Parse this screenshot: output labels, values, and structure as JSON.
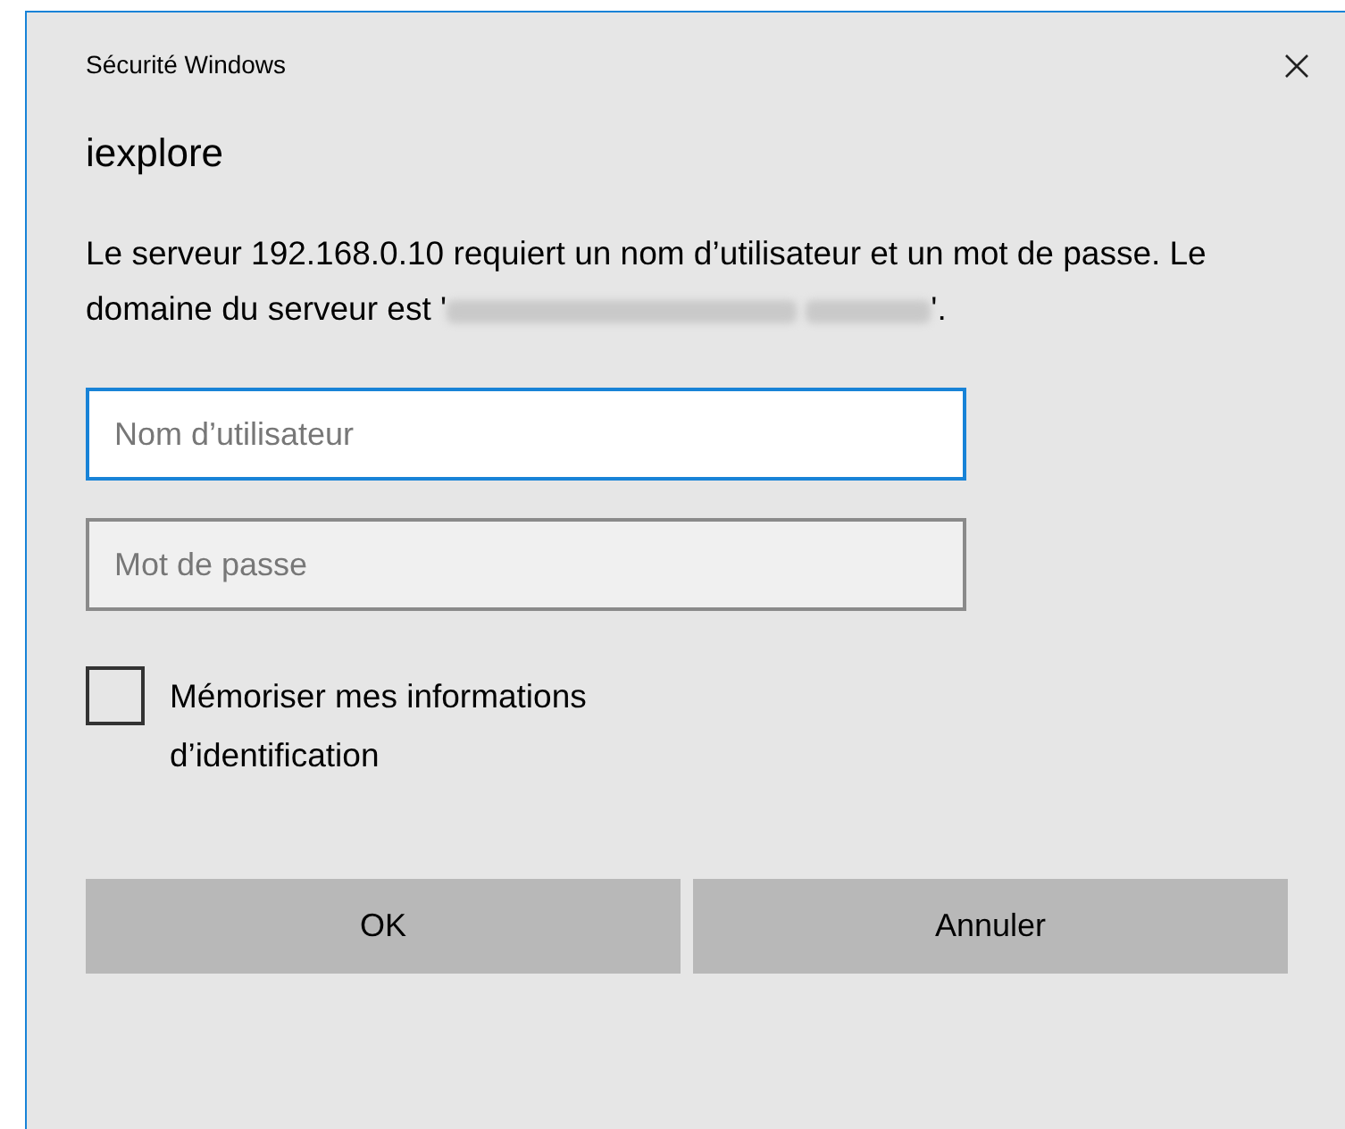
{
  "window": {
    "title": "Sécurité Windows"
  },
  "app_name": "iexplore",
  "message": {
    "text": "Le serveur 192.168.0.10 requiert un nom d’utilisateur et un mot de passe. Le domaine du serveur est '",
    "text_after": "'."
  },
  "fields": [
    {
      "placeholder": "Nom d’utilisateur",
      "focused": true
    },
    {
      "placeholder": "Mot de passe",
      "focused": false
    }
  ],
  "remember": {
    "label": "Mémoriser mes informations d’identification",
    "checked": false
  },
  "buttons": [
    "OK",
    "Annuler"
  ]
}
